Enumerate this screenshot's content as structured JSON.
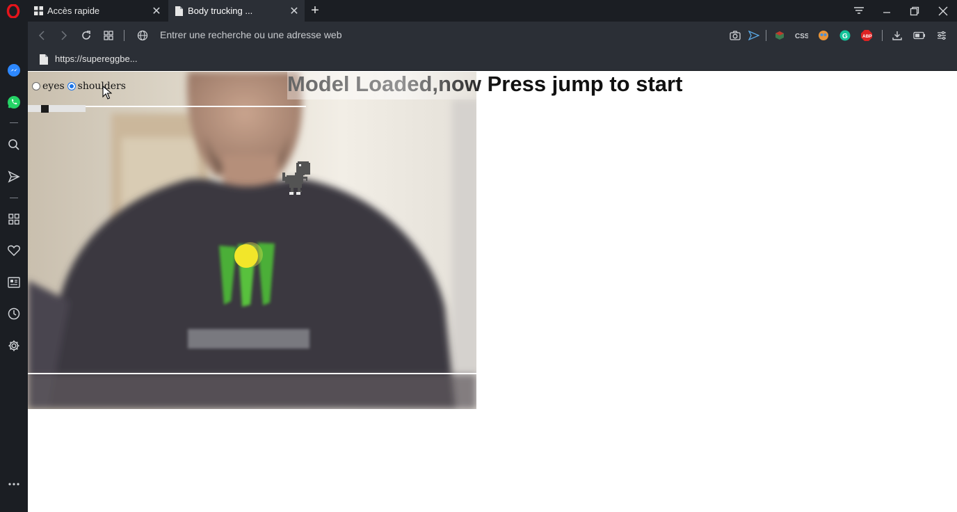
{
  "tabs": [
    {
      "label": "Accès rapide",
      "icon": "grid-icon"
    },
    {
      "label": "Body trucking ...",
      "icon": "document-icon"
    }
  ],
  "address_bar": {
    "placeholder": "Entrer une recherche ou une adresse web"
  },
  "bookmarks": {
    "url": "https://supereggbe..."
  },
  "page": {
    "heading": "Model Loaded,now Press jump to start",
    "radio_options": [
      {
        "label": "eyes",
        "selected": false
      },
      {
        "label": "shoulders",
        "selected": true
      }
    ]
  },
  "colors": {
    "chrome_dark": "#1b1e23",
    "chrome_mid": "#2b2f36",
    "tracking_dot": "#f2e62a",
    "opera_red": "#e5141b"
  }
}
